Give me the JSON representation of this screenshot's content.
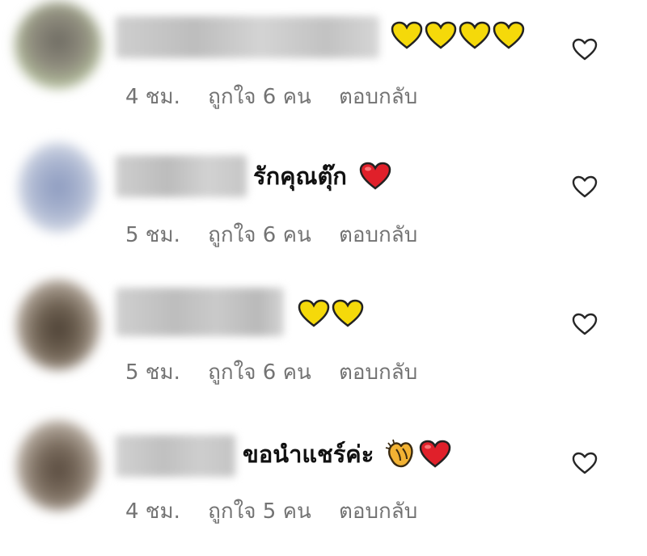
{
  "comments": [
    {
      "text": "",
      "emoji": [
        "yellow-heart",
        "yellow-heart",
        "yellow-heart",
        "yellow-heart"
      ],
      "time": "4 ชม.",
      "likes": "ถูกใจ 6 คน",
      "reply": "ตอบกลับ"
    },
    {
      "text": "รักคุณตุ๊ก",
      "emoji": [
        "red-heart"
      ],
      "time": "5 ชม.",
      "likes": "ถูกใจ 6 คน",
      "reply": "ตอบกลับ"
    },
    {
      "text": "",
      "emoji": [
        "yellow-heart",
        "yellow-heart"
      ],
      "time": "5 ชม.",
      "likes": "ถูกใจ 6 คน",
      "reply": "ตอบกลับ"
    },
    {
      "text": "ขอนำแชร์ค่ะ",
      "emoji": [
        "clapping-hands",
        "red-heart"
      ],
      "time": "4 ชม.",
      "likes": "ถูกใจ 5 คน",
      "reply": "ตอบกลับ"
    }
  ],
  "colors": {
    "yellow_heart": "#f5d90a",
    "red_heart": "#e0202a",
    "meta_text": "#737373",
    "comment_text": "#111111"
  },
  "icons": {
    "like": "heart-outline-icon"
  }
}
